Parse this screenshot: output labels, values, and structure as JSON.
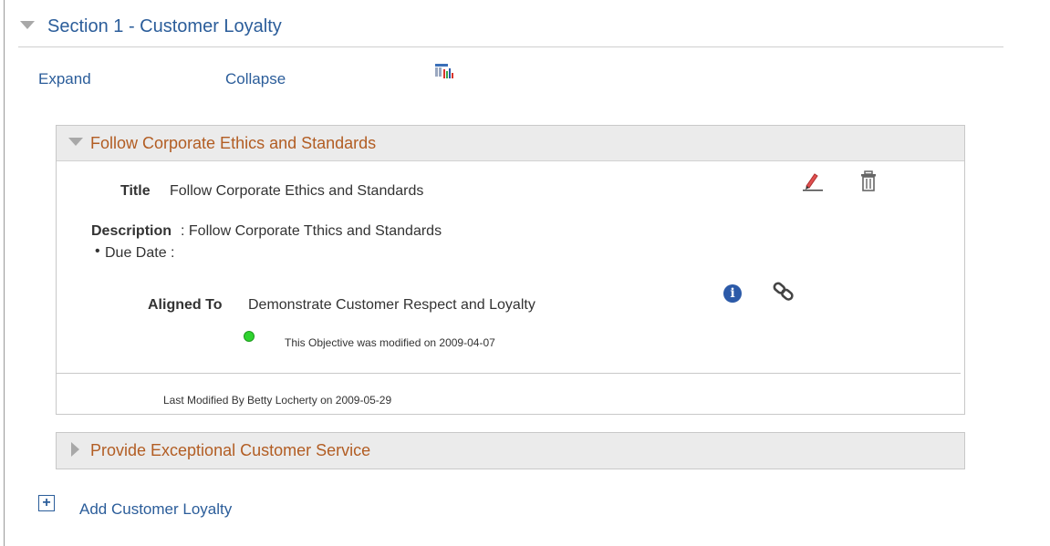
{
  "section": {
    "title": "Section 1 - Customer Loyalty",
    "expand_label": "Expand",
    "collapse_label": "Collapse",
    "chart_icon": "chart-icon"
  },
  "objectives": [
    {
      "title": "Follow Corporate Ethics and Standards",
      "expanded": true,
      "fields": {
        "title_label": "Title",
        "title_value": "Follow Corporate Ethics and Standards",
        "description_label": "Description",
        "description_value": ": Follow Corporate Tthics and Standards",
        "due_date_label": "Due Date :",
        "aligned_label": "Aligned To",
        "aligned_value": "Demonstrate Customer Respect and Loyalty",
        "modified_note": "This Objective was modified on 2009-04-07",
        "last_modified": "Last Modified By  Betty Locherty on 2009-05-29"
      },
      "icons": [
        "edit-icon",
        "delete-icon",
        "info-icon",
        "link-icon"
      ]
    },
    {
      "title": "Provide Exceptional Customer Service",
      "expanded": false
    }
  ],
  "add_link": "Add Customer Loyalty",
  "colors": {
    "link": "#2b5d9a",
    "group_title": "#b25d23",
    "status_dot": "#2fd32f"
  }
}
